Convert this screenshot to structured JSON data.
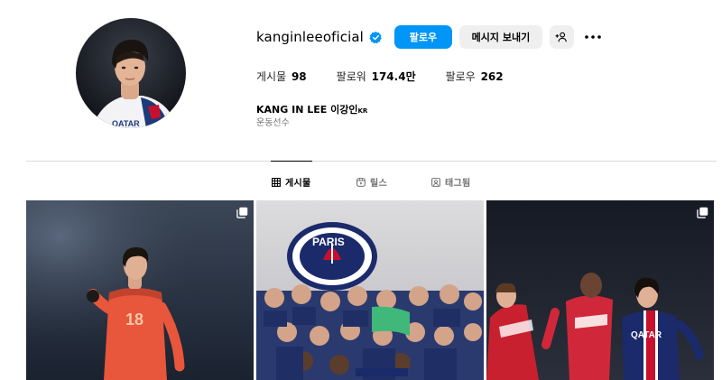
{
  "profile": {
    "username": "kanginleeoficial",
    "follow_label": "팔로우",
    "message_label": "메시지 보내기",
    "stats": {
      "posts_label": "게시물",
      "posts_value": "98",
      "followers_label": "팔로워",
      "followers_value": "174.4만",
      "following_label": "팔로우",
      "following_value": "262"
    },
    "full_name": "KANG IN LEE 이강인",
    "name_flag": "KR",
    "category": "운동선수"
  },
  "tabs": {
    "posts": "게시물",
    "reels": "릴스",
    "tagged": "태그됨"
  },
  "posts": [
    {
      "text": "18"
    },
    {
      "text": "PARIS"
    },
    {
      "text": "QATAR"
    }
  ],
  "colors": {
    "accent": "#0095f6",
    "verified": "#0095f6",
    "button_bg": "#efefef",
    "divider": "#dbdbdb"
  },
  "icons": {
    "verified": "verified-badge-icon",
    "add_person": "add-person-icon",
    "more": "more-options-icon",
    "grid": "grid-icon",
    "reels": "reels-icon",
    "tagged": "tagged-icon",
    "multi": "multiple-posts-icon"
  }
}
